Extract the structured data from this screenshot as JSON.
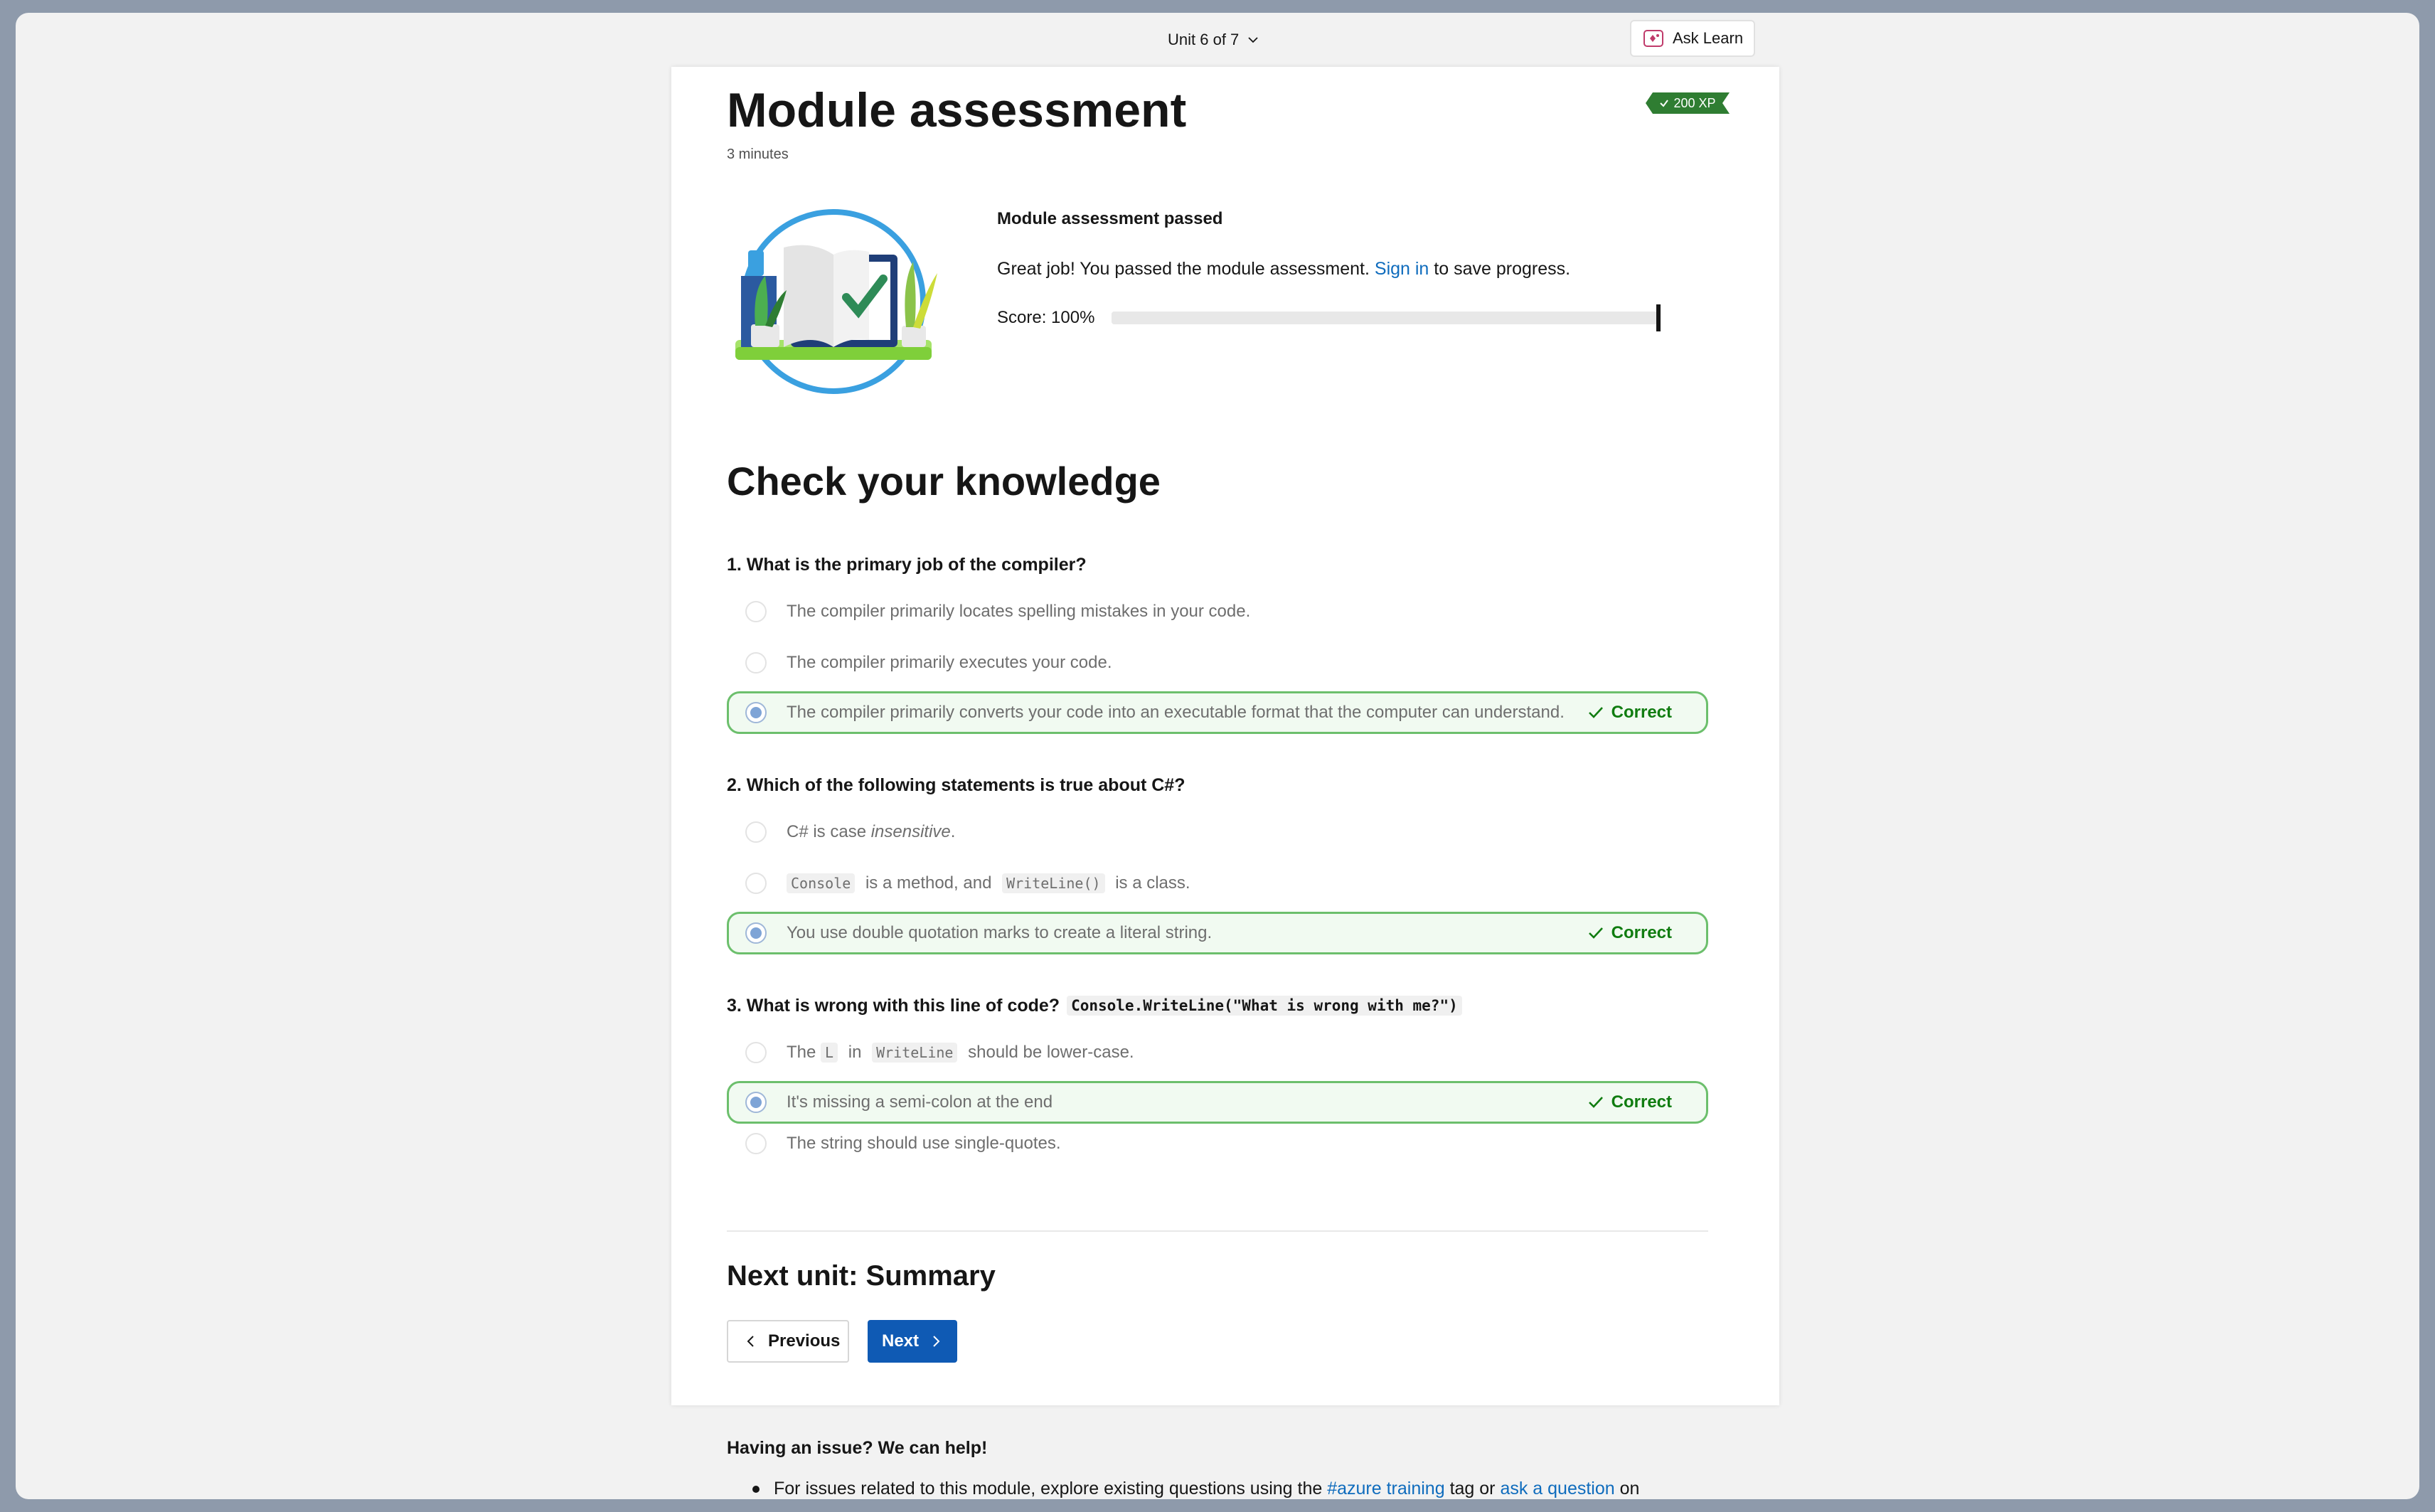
{
  "topbar": {
    "unit_selector": "Unit 6 of 7",
    "ask_learn": "Ask Learn"
  },
  "page": {
    "title": "Module assessment",
    "duration": "3 minutes",
    "xp_badge": "200 XP"
  },
  "result": {
    "title": "Module assessment passed",
    "text_before": "Great job! You passed the module assessment. ",
    "sign_in_link": "Sign in",
    "text_after": " to save progress.",
    "score_label": "Score: 100%",
    "score_fraction": 1.0
  },
  "check": {
    "title": "Check your knowledge",
    "correct_label": "Correct",
    "questions": [
      {
        "text": "1. What is the primary job of the compiler?",
        "options": [
          {
            "label": "The compiler primarily locates spelling mistakes in your code."
          },
          {
            "label": "The compiler primarily executes your code."
          },
          {
            "label": "The compiler primarily converts your code into an executable format that the computer can understand."
          }
        ]
      },
      {
        "text": "2. Which of the following statements is true about C#?",
        "options": [
          {
            "pre": "C# is case ",
            "em": "insensitive",
            "post": "."
          },
          {
            "code1": "Console",
            "mid": " is a method, and ",
            "code2": "WriteLine()",
            "post": " is a class."
          },
          {
            "label": "You use double quotation marks to create a literal string."
          }
        ]
      },
      {
        "text": "3. What is wrong with this line of code?",
        "code": "Console.WriteLine(\"What is wrong with me?\")",
        "options": [
          {
            "pre": "The ",
            "code1": "L",
            "mid": " in ",
            "code2": "WriteLine",
            "post": " should be lower-case."
          },
          {
            "label": "It's missing a semi-colon at the end"
          },
          {
            "label": "The string should use single-quotes."
          }
        ]
      }
    ]
  },
  "navigation": {
    "next_unit": "Next unit: Summary",
    "previous": "Previous",
    "next": "Next"
  },
  "help": {
    "title": "Having an issue? We can help!",
    "item_pre": "For issues related to this module, explore existing questions using the ",
    "tag_link": "#azure training",
    "item_mid": " tag or ",
    "ask_link": "ask a question",
    "item_post": " on"
  },
  "colors": {
    "accent": "#0f5ab4",
    "link": "#0f6cbd",
    "correct": "#107c10",
    "xp_badge": "#2f7d32"
  }
}
